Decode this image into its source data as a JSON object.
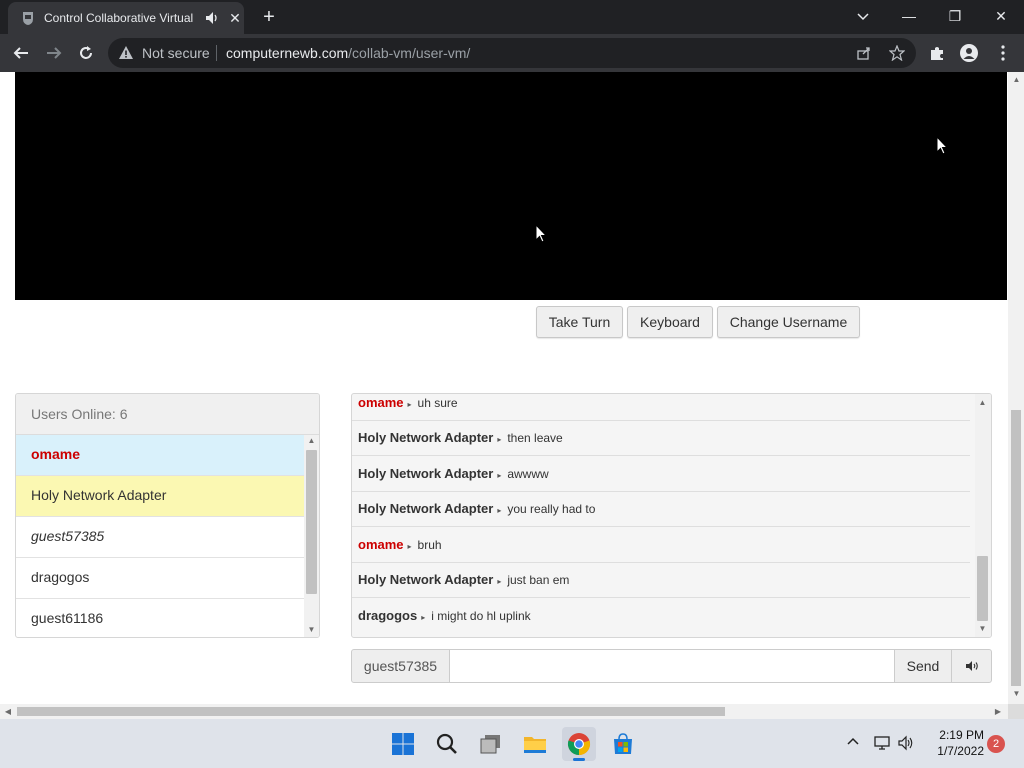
{
  "browser": {
    "tab_title": "Control Collaborative Virtual",
    "new_tab_symbol": "+",
    "close_tab_symbol": "✕",
    "not_secure_label": "Not secure",
    "url_host": "computernewb.com",
    "url_path": "/collab-vm/user-vm/",
    "window_minimize": "—",
    "window_restore": "❐",
    "window_close": "✕"
  },
  "vm_controls": {
    "take_turn_label": "Take Turn",
    "keyboard_label": "Keyboard",
    "change_username_label": "Change Username"
  },
  "users": {
    "header": "Users Online: 6",
    "list": [
      {
        "name": "omame",
        "style": "admin"
      },
      {
        "name": "Holy Network Adapter",
        "style": "highlight"
      },
      {
        "name": "guest57385",
        "style": "self"
      },
      {
        "name": "dragogos",
        "style": "normal"
      },
      {
        "name": "guest61186",
        "style": "normal"
      }
    ]
  },
  "chat": {
    "messages": [
      {
        "user": "omame",
        "text": "uh sure",
        "admin": true
      },
      {
        "user": "Holy Network Adapter",
        "text": "then leave",
        "admin": false
      },
      {
        "user": "Holy Network Adapter",
        "text": "awwww",
        "admin": false
      },
      {
        "user": "Holy Network Adapter",
        "text": "you really had to",
        "admin": false
      },
      {
        "user": "omame",
        "text": "bruh",
        "admin": true
      },
      {
        "user": "Holy Network Adapter",
        "text": "just ban em",
        "admin": false
      },
      {
        "user": "dragogos",
        "text": "i might do hl uplink",
        "admin": false
      }
    ],
    "username": "guest57385",
    "input_value": "",
    "send_label": "Send"
  },
  "taskbar": {
    "time": "2:19 PM",
    "date": "1/7/2022",
    "notifications": "2"
  },
  "colors": {
    "admin_red": "#cc0000",
    "selected_blue": "#d9f1fb",
    "highlight_yellow": "#fbf8b2",
    "browser_dark": "#202124"
  }
}
